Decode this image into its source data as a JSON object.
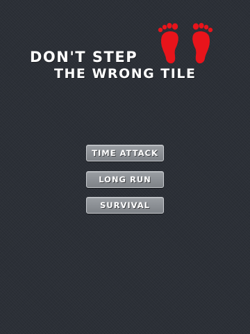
{
  "title": {
    "line1": "DON'T STEP",
    "line2": "THE WRONG TILE"
  },
  "logo_icon": "footprints-icon",
  "colors": {
    "background": "#2b2f36",
    "feet": "#e8141b",
    "button": "#8c9095",
    "button_border": "#c9ccd0",
    "text": "#ffffff"
  },
  "menu": {
    "buttons": [
      {
        "label": "TIME ATTACK"
      },
      {
        "label": "LONG RUN"
      },
      {
        "label": "SURVIVAL"
      }
    ]
  }
}
